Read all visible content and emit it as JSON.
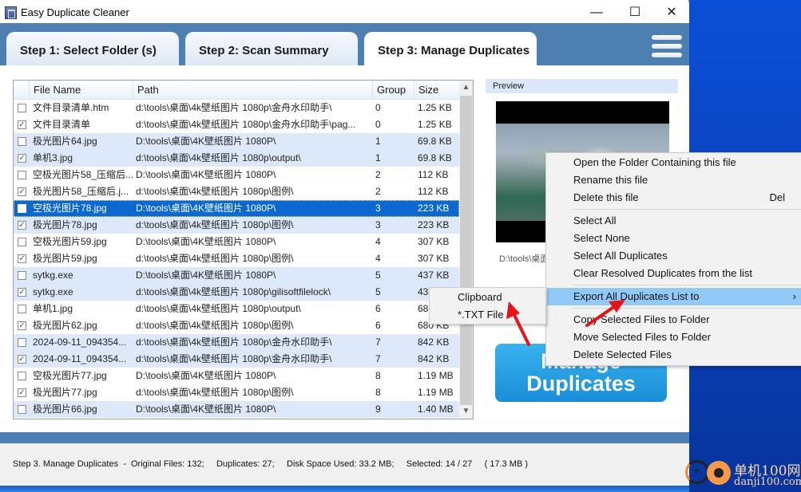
{
  "window": {
    "title": "Easy Duplicate Cleaner",
    "minimize_glyph": "—",
    "maximize_glyph": "☐",
    "close_glyph": "✕"
  },
  "tabs": [
    {
      "label": "Step 1: Select Folder (s)",
      "active": false
    },
    {
      "label": "Step 2: Scan Summary",
      "active": false
    },
    {
      "label": "Step 3: Manage Duplicates",
      "active": true
    }
  ],
  "table": {
    "columns": [
      "File Name",
      "Path",
      "Group",
      "Size"
    ],
    "rows": [
      {
        "checked": false,
        "name": "文件目录清单.htm",
        "path": "d:\\tools\\桌面\\4k壁纸图片 1080p\\金舟水印助手\\",
        "group": "0",
        "size": "1.25 KB",
        "shade": false,
        "selected": false
      },
      {
        "checked": true,
        "name": "文件目录清单",
        "path": "d:\\tools\\桌面\\4k壁纸图片 1080p\\金舟水印助手\\pag...",
        "group": "0",
        "size": "1.25 KB",
        "shade": false,
        "selected": false
      },
      {
        "checked": false,
        "name": "极光图片64.jpg",
        "path": "D:\\tools\\桌面\\4K壁纸图片 1080P\\",
        "group": "1",
        "size": "69.8 KB",
        "shade": true,
        "selected": false
      },
      {
        "checked": true,
        "name": "单机3.jpg",
        "path": "d:\\tools\\桌面\\4k壁纸图片 1080p\\output\\",
        "group": "1",
        "size": "69.8 KB",
        "shade": true,
        "selected": false
      },
      {
        "checked": false,
        "name": "空极光图片58_压缩后...",
        "path": "D:\\tools\\桌面\\4K壁纸图片 1080P\\",
        "group": "2",
        "size": "112 KB",
        "shade": false,
        "selected": false
      },
      {
        "checked": true,
        "name": "极光图片58_压缩后.j...",
        "path": "d:\\tools\\桌面\\4k壁纸图片 1080p\\图例\\",
        "group": "2",
        "size": "112 KB",
        "shade": false,
        "selected": false
      },
      {
        "checked": false,
        "name": "空极光图片78.jpg",
        "path": "D:\\tools\\桌面\\4K壁纸图片 1080P\\",
        "group": "3",
        "size": "223 KB",
        "shade": true,
        "selected": true
      },
      {
        "checked": true,
        "name": "极光图片78.jpg",
        "path": "d:\\tools\\桌面\\4k壁纸图片 1080p\\图例\\",
        "group": "3",
        "size": "223 KB",
        "shade": true,
        "selected": false
      },
      {
        "checked": false,
        "name": "空极光图片59.jpg",
        "path": "D:\\tools\\桌面\\4K壁纸图片 1080P\\",
        "group": "4",
        "size": "307 KB",
        "shade": false,
        "selected": false
      },
      {
        "checked": true,
        "name": "极光图片59.jpg",
        "path": "d:\\tools\\桌面\\4k壁纸图片 1080p\\图例\\",
        "group": "4",
        "size": "307 KB",
        "shade": false,
        "selected": false
      },
      {
        "checked": false,
        "name": "sytkg.exe",
        "path": "D:\\tools\\桌面\\4K壁纸图片 1080P\\",
        "group": "5",
        "size": "437 KB",
        "shade": true,
        "selected": false
      },
      {
        "checked": true,
        "name": "sytkg.exe",
        "path": "d:\\tools\\桌面\\4k壁纸图片 1080p\\gilisoftfilelock\\",
        "group": "5",
        "size": "437 KB",
        "shade": true,
        "selected": false
      },
      {
        "checked": false,
        "name": "单机1.jpg",
        "path": "d:\\tools\\桌面\\4k壁纸图片 1080p\\output\\",
        "group": "6",
        "size": "680 KB",
        "shade": false,
        "selected": false
      },
      {
        "checked": true,
        "name": "极光图片62.jpg",
        "path": "d:\\tools\\桌面\\4k壁纸图片 1080p\\图例\\",
        "group": "6",
        "size": "680 KB",
        "shade": false,
        "selected": false
      },
      {
        "checked": false,
        "name": "2024-09-11_094354...",
        "path": "d:\\tools\\桌面\\4k壁纸图片 1080p\\金舟水印助手\\",
        "group": "7",
        "size": "842 KB",
        "shade": true,
        "selected": false
      },
      {
        "checked": true,
        "name": "2024-09-11_094354...",
        "path": "d:\\tools\\桌面\\4k壁纸图片 1080p\\金舟水印助手\\",
        "group": "7",
        "size": "842 KB",
        "shade": true,
        "selected": false
      },
      {
        "checked": false,
        "name": "空极光图片77.jpg",
        "path": "D:\\tools\\桌面\\4K壁纸图片 1080P\\",
        "group": "8",
        "size": "1.19 MB",
        "shade": false,
        "selected": false
      },
      {
        "checked": true,
        "name": "极光图片77.jpg",
        "path": "d:\\tools\\桌面\\4k壁纸图片 1080p\\图例\\",
        "group": "8",
        "size": "1.19 MB",
        "shade": false,
        "selected": false
      },
      {
        "checked": false,
        "name": "极光图片66.jpg",
        "path": "D:\\tools\\桌面\\4K壁纸图片 1080P\\",
        "group": "9",
        "size": "1.40 MB",
        "shade": true,
        "selected": false
      }
    ]
  },
  "preview": {
    "title": "Preview",
    "path": "D:\\tools\\桌面"
  },
  "manage_button": {
    "line1": "Manage",
    "line2": "Duplicates"
  },
  "context_menu": {
    "items": [
      {
        "label": "Open the Folder Containing this file",
        "shortcut": "",
        "submenu": false,
        "highlighted": false
      },
      {
        "label": "Rename this file",
        "shortcut": "",
        "submenu": false,
        "highlighted": false
      },
      {
        "label": "Delete this file",
        "shortcut": "Del",
        "submenu": false,
        "highlighted": false
      },
      {
        "separator": true
      },
      {
        "label": "Select All",
        "shortcut": "",
        "submenu": false,
        "highlighted": false
      },
      {
        "label": "Select None",
        "shortcut": "",
        "submenu": false,
        "highlighted": false
      },
      {
        "label": "Select All Duplicates",
        "shortcut": "",
        "submenu": false,
        "highlighted": false
      },
      {
        "label": "Clear Resolved Duplicates from the list",
        "shortcut": "",
        "submenu": false,
        "highlighted": false
      },
      {
        "separator": true
      },
      {
        "label": "Export All Duplicates List to",
        "shortcut": "",
        "submenu": true,
        "highlighted": true
      },
      {
        "separator": true
      },
      {
        "label": "Copy Selected Files to Folder",
        "shortcut": "",
        "submenu": false,
        "highlighted": false
      },
      {
        "label": "Move Selected Files to Folder",
        "shortcut": "",
        "submenu": false,
        "highlighted": false
      },
      {
        "label": "Delete Selected Files",
        "shortcut": "",
        "submenu": false,
        "highlighted": false
      }
    ],
    "submenu_arrow": "›"
  },
  "submenu": {
    "items": [
      "Clipboard",
      "*.TXT File"
    ]
  },
  "status": {
    "text": "Step 3. Manage Duplicates  -  Original Files: 132;     Duplicates: 27;     Disk Space Used: 33.2 MB;     Selected: 14 / 27     ( 17.3 MB )"
  },
  "watermark": {
    "cn": "单机100网",
    "en": "danji100.com"
  },
  "colors": {
    "tab_bar": "#4e7fb2",
    "selection": "#0a68d0",
    "row_shade": "#dde9fa",
    "menu_highlight": "#91c9f7",
    "annotation_arrow": "#e5141a"
  }
}
